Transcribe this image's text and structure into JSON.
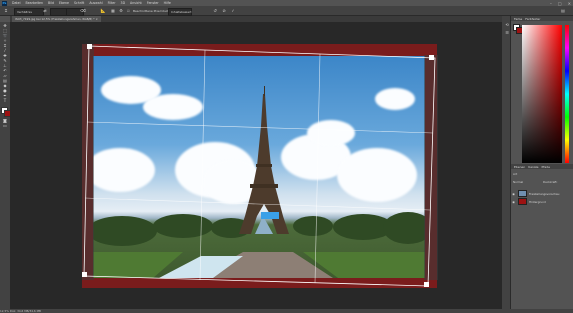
{
  "menu": [
    "Datei",
    "Bearbeiten",
    "Bild",
    "Ebene",
    "Schrift",
    "Auswahl",
    "Filter",
    "3D",
    "Ansicht",
    "Fenster",
    "Hilfe"
  ],
  "app_logo": "Ps",
  "window_controls": [
    "–",
    "□",
    "✕"
  ],
  "options_bar": {
    "ratio_value": "Verhältnis",
    "straighten_label": "Gerade ausr.",
    "delete_cropped_label": "Inhaltsbas.",
    "check_label": "Beschnittene Pixel löschen",
    "fill_label": "Inhaltsbasiert",
    "zoom_label": "3D",
    "cancel_icon": "⊘",
    "commit_icon": "✓",
    "reset_icon": "↺"
  },
  "document_tab": "ISO3_7199.jpg bei 12,5% (Freistellungsrahmen, RGB/8) * ×",
  "status_bar": "12,5%   Dok: 34,6 MB/34,6 MB",
  "panels": {
    "color_tabs": [
      "Farbe",
      "Farbfelder"
    ],
    "layers_tabs": [
      "Ebenen",
      "Kanäle",
      "Pfade"
    ],
    "layers_filter_label": "Art",
    "blend_mode": "Normal",
    "opacity_label": "Deckkraft:",
    "layers": [
      {
        "name": "Freistellungsvorschau"
      },
      {
        "name": "Hintergrund"
      }
    ]
  },
  "colors": {
    "foreground": "#ffffff",
    "background": "#9d1212",
    "crop_canvas_fill": "#7a1c1c",
    "canvas_bg": "#282828"
  },
  "tools": [
    "move-icon",
    "marquee-icon",
    "lasso-icon",
    "magic-wand-icon",
    "crop-icon",
    "eyedropper-icon",
    "healing-icon",
    "brush-icon",
    "stamp-icon",
    "history-brush-icon",
    "eraser-icon",
    "gradient-icon",
    "blur-icon",
    "dodge-icon",
    "pen-icon",
    "type-icon",
    "path-select-icon",
    "shape-icon",
    "hand-icon",
    "zoom-icon"
  ]
}
